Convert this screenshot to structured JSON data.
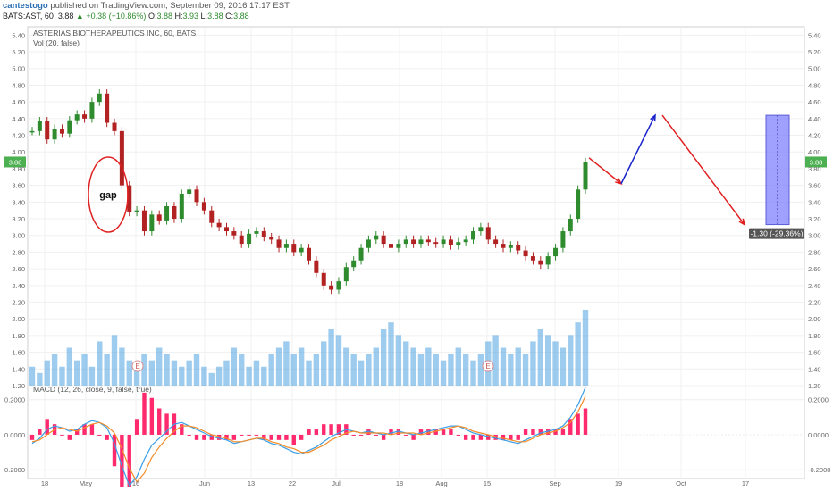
{
  "header": {
    "author": "cantestogo",
    "published": " published on TradingView.com, September 09, 2016 17:17 EST",
    "symbol": "BATS:AST, 60",
    "last": "3.88",
    "change_arrow": "▲",
    "change": "+0.38 (+10.86%)",
    "o_label": "O:",
    "o": "3.88",
    "h_label": "H:",
    "h": "3.93",
    "l_label": "L:",
    "l": "3.88",
    "c_label": "C:",
    "c": "3.88"
  },
  "chart_data": [
    {
      "type": "candlestick",
      "title": "ASTERIAS BIOTHERAPEUTICS INC, 60, BATS",
      "study_label": "Vol (20, false)",
      "ylim": [
        1.2,
        5.5
      ],
      "y_ticks": [
        "5.40",
        "5.20",
        "5.00",
        "4.80",
        "4.60",
        "4.40",
        "4.20",
        "4.00",
        "3.80",
        "3.60",
        "3.40",
        "3.20",
        "3.00",
        "2.80",
        "2.60",
        "2.40",
        "2.20",
        "2.00",
        "1.80",
        "1.60",
        "1.40",
        "1.20"
      ],
      "x_ticks": [
        "18",
        "May",
        "16",
        "Jun",
        "13",
        "22",
        "Jul",
        "18",
        "Aug",
        "15",
        "Sep",
        "19",
        "Oct",
        "17"
      ],
      "last_price_label": "3.88",
      "price_path": [
        4.25,
        4.37,
        4.15,
        4.28,
        4.22,
        4.38,
        4.45,
        4.4,
        4.6,
        4.7,
        4.35,
        4.25,
        3.6,
        3.28,
        3.3,
        3.05,
        3.25,
        3.18,
        3.35,
        3.2,
        3.5,
        3.55,
        3.4,
        3.3,
        3.15,
        3.1,
        3.05,
        3.0,
        2.9,
        3.02,
        3.05,
        2.98,
        2.95,
        2.85,
        2.9,
        2.8,
        2.85,
        2.7,
        2.55,
        2.4,
        2.35,
        2.45,
        2.62,
        2.7,
        2.85,
        2.95,
        3.0,
        2.9,
        2.85,
        2.9,
        2.95,
        2.9,
        2.95,
        2.92,
        2.9,
        2.95,
        2.88,
        2.92,
        2.95,
        3.05,
        3.1,
        2.95,
        2.9,
        2.85,
        2.88,
        2.82,
        2.75,
        2.7,
        2.65,
        2.75,
        2.85,
        3.05,
        3.2,
        3.55,
        3.88
      ],
      "annotations": {
        "gap_label": "gap",
        "earnings_marker": "E",
        "measure_label": "-1.30 (-29.36%)"
      },
      "projection": [
        {
          "date_index": 0,
          "price": 3.93
        },
        {
          "date_index": 1,
          "price": 3.62
        },
        {
          "date_index": 2,
          "price": 4.44
        },
        {
          "date_index": 3,
          "price": 3.13
        }
      ],
      "volume": [
        0.3,
        0.2,
        0.4,
        0.5,
        0.3,
        0.6,
        0.4,
        0.5,
        0.3,
        0.7,
        0.5,
        0.8,
        0.6,
        0.4,
        0.3,
        0.5,
        0.4,
        0.6,
        0.5,
        0.4,
        0.3,
        0.4,
        0.5,
        0.3,
        0.2,
        0.3,
        0.4,
        0.6,
        0.5,
        0.3,
        0.4,
        0.3,
        0.5,
        0.6,
        0.7,
        0.5,
        0.6,
        0.4,
        0.5,
        0.7,
        0.9,
        0.8,
        0.6,
        0.5,
        0.4,
        0.5,
        0.6,
        0.9,
        1.0,
        0.8,
        0.7,
        0.6,
        0.5,
        0.6,
        0.5,
        0.4,
        0.5,
        0.6,
        0.5,
        0.4,
        0.5,
        0.7,
        0.8,
        0.6,
        0.5,
        0.6,
        0.5,
        0.7,
        0.9,
        0.8,
        0.7,
        0.6,
        0.8,
        1.0,
        1.2
      ]
    },
    {
      "type": "line",
      "title": "MACD (12, 26, close, 9, false, true)",
      "ylim": [
        -0.25,
        0.28
      ],
      "y_ticks": [
        "0.2000",
        "0.0000",
        "-0.2000"
      ],
      "series": [
        {
          "color": "#3a9ee6",
          "values": [
            -0.05,
            -0.02,
            0.03,
            0.05,
            0.04,
            0.02,
            0.03,
            0.06,
            0.08,
            0.07,
            0.04,
            -0.05,
            -0.18,
            -0.29,
            -0.24,
            -0.14,
            -0.06,
            -0.02,
            0.02,
            0.06,
            0.07,
            0.05,
            0.03,
            0.01,
            -0.01,
            -0.02,
            -0.03,
            -0.05,
            -0.04,
            -0.03,
            -0.02,
            -0.03,
            -0.05,
            -0.06,
            -0.08,
            -0.1,
            -0.11,
            -0.09,
            -0.07,
            -0.04,
            -0.01,
            0.01,
            0.03,
            0.02,
            0.01,
            0.02,
            0.01,
            0.0,
            0.01,
            0.02,
            0.01,
            0.0,
            0.01,
            0.02,
            0.03,
            0.04,
            0.05,
            0.05,
            0.03,
            0.01,
            0.0,
            -0.01,
            -0.02,
            -0.03,
            -0.04,
            -0.05,
            -0.03,
            -0.01,
            0.01,
            0.02,
            0.03,
            0.05,
            0.1,
            0.17,
            0.27
          ]
        },
        {
          "color": "#f28c28",
          "values": [
            -0.04,
            -0.03,
            0.0,
            0.03,
            0.04,
            0.03,
            0.02,
            0.04,
            0.06,
            0.07,
            0.05,
            0.01,
            -0.08,
            -0.19,
            -0.27,
            -0.22,
            -0.13,
            -0.07,
            -0.02,
            0.02,
            0.05,
            0.05,
            0.04,
            0.02,
            0.0,
            -0.01,
            -0.02,
            -0.04,
            -0.04,
            -0.03,
            -0.02,
            -0.02,
            -0.04,
            -0.05,
            -0.07,
            -0.08,
            -0.1,
            -0.1,
            -0.08,
            -0.06,
            -0.03,
            -0.01,
            0.01,
            0.02,
            0.01,
            0.01,
            0.01,
            0.01,
            0.0,
            0.01,
            0.01,
            0.01,
            0.0,
            0.01,
            0.02,
            0.03,
            0.04,
            0.05,
            0.04,
            0.02,
            0.01,
            0.0,
            -0.01,
            -0.02,
            -0.03,
            -0.04,
            -0.04,
            -0.02,
            0.0,
            0.01,
            0.02,
            0.04,
            0.07,
            0.13,
            0.22
          ]
        }
      ]
    }
  ],
  "colors": {
    "up": "#2e8b2e",
    "down": "#b22222",
    "volume": "#4fa3e0",
    "projection_down": "#e02020",
    "projection_up": "#1a22cc",
    "measure_box": "#8080ff",
    "hist": "#ff2a6d",
    "price_line": "#a5d6a7",
    "last_tag": "#4caf50",
    "measure_tag": "#555555"
  },
  "icons": {
    "change_arrow": "up-triangle-icon"
  }
}
